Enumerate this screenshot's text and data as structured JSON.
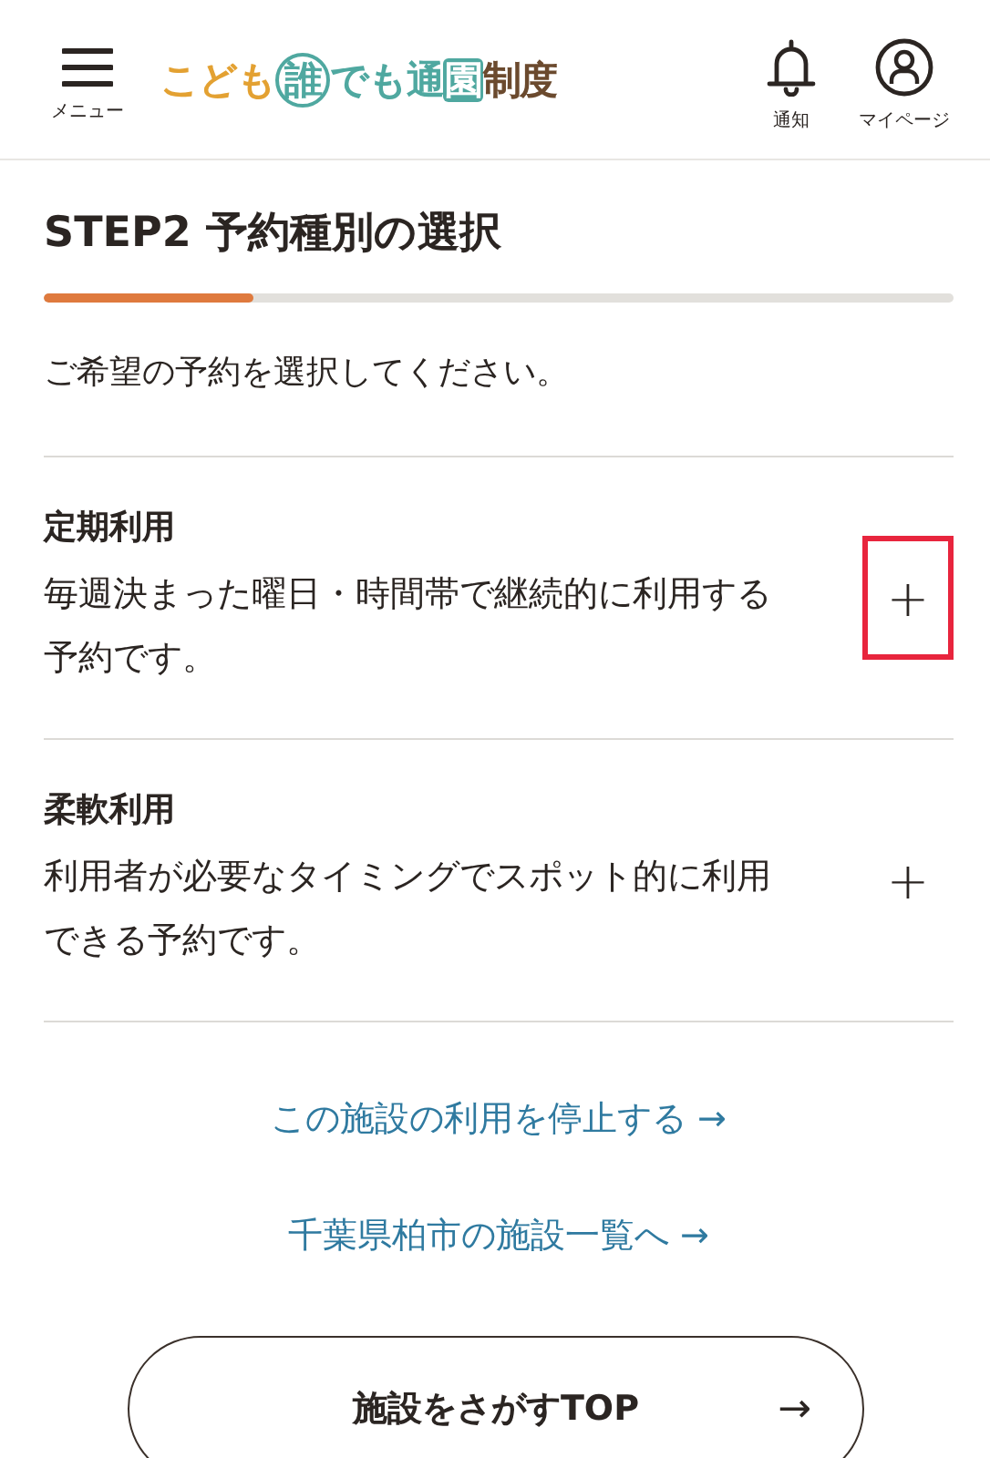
{
  "header": {
    "menu_label": "メニュー",
    "logo": [
      {
        "text": "こども",
        "color": "#e3a132",
        "kind": "plain"
      },
      {
        "text": "誰",
        "color": "#4fa8a0",
        "kind": "circle"
      },
      {
        "text": "でも通",
        "color": "#4fa8a0",
        "kind": "plain"
      },
      {
        "text": "園",
        "color": "#4fa8a0",
        "kind": "box"
      },
      {
        "text": "制度",
        "color": "#6b4a2e",
        "kind": "plain"
      }
    ],
    "actions": [
      {
        "label": "通知",
        "kind": "bell"
      },
      {
        "label": "マイページ",
        "kind": "user"
      }
    ]
  },
  "title": "STEP2 予約種別の選択",
  "progress": {
    "level": 0.23
  },
  "intro": "ご希望の予約を選択してください。",
  "options": [
    {
      "title": "定期利用",
      "description": "毎週決まった曜日・時間帯で継続的に利用する予約です。",
      "toggle": "+",
      "highlighted": true
    },
    {
      "title": "柔軟利用",
      "description": "利用者が必要なタイミングでスポット的に利用できる予約です。",
      "toggle": "+",
      "highlighted": false
    }
  ],
  "links": [
    "この施設の利用を停止する →",
    "千葉県柏市の施設一覧へ →"
  ],
  "top_button": {
    "label": "施設をさがすTOP",
    "arrow": "→"
  }
}
